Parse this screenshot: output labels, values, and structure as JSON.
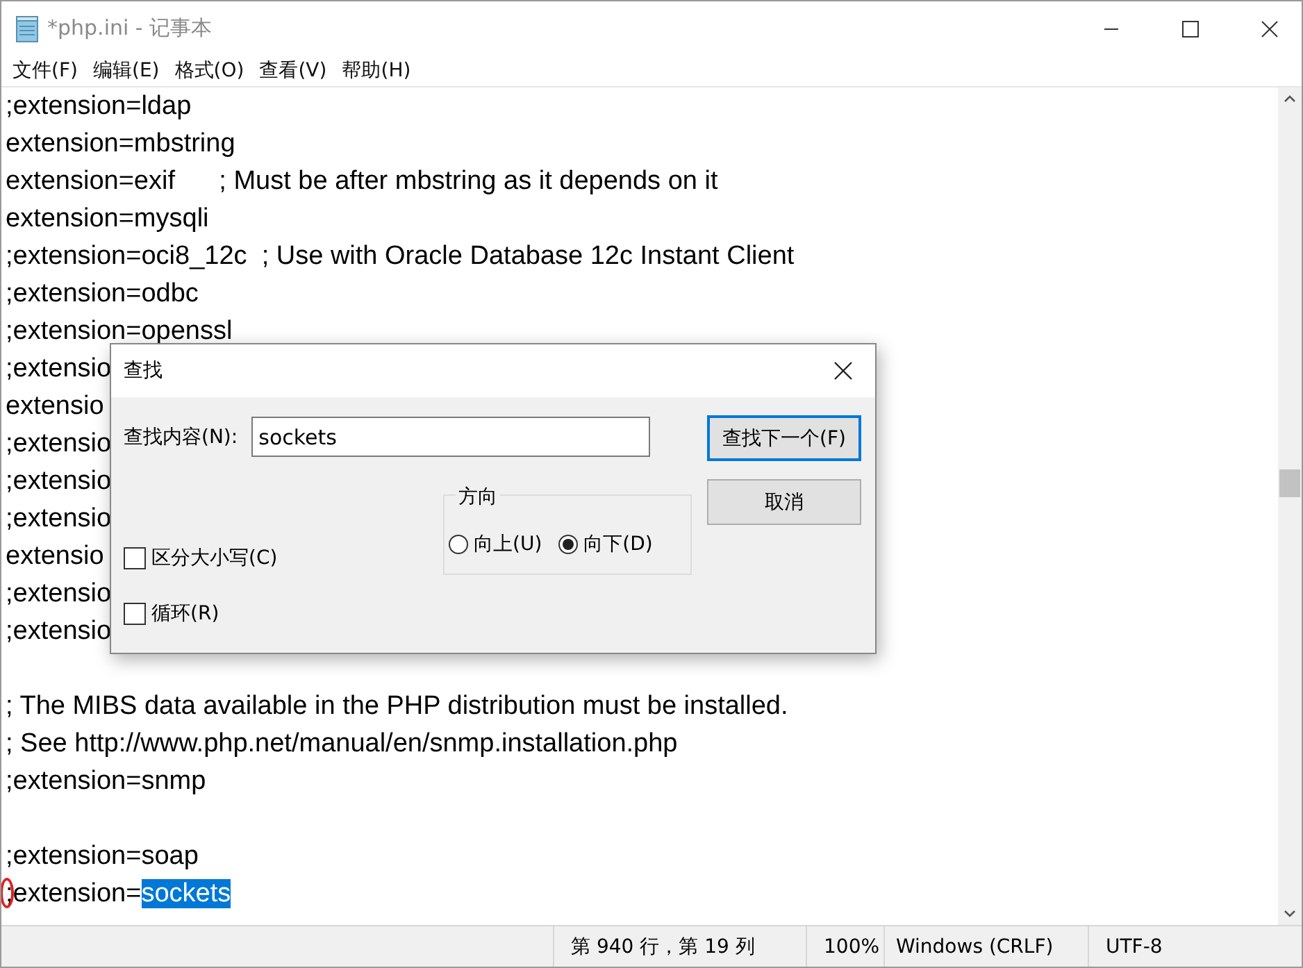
{
  "window": {
    "title": "*php.ini - 记事本"
  },
  "menu": [
    "文件(F)",
    "编辑(E)",
    "格式(O)",
    "查看(V)",
    "帮助(H)"
  ],
  "editor": {
    "lines": [
      {
        "kind": "text",
        "text": ";extension=ldap",
        "circled": false
      },
      {
        "kind": "text",
        "text": "extension=mbstring",
        "circled": false
      },
      {
        "kind": "text",
        "text": "extension=exif      ; Must be after mbstring as it depends on it",
        "circled": false
      },
      {
        "kind": "text",
        "text": "extension=mysqli",
        "circled": false
      },
      {
        "kind": "text",
        "text": ";extension=oci8_12c  ; Use with Oracle Database 12c Instant Client",
        "circled": false
      },
      {
        "kind": "text",
        "text": ";extension=odbc",
        "circled": false
      },
      {
        "kind": "text",
        "text": ";extension=openssl",
        "circled": false
      },
      {
        "kind": "text",
        "text": ";extensio",
        "circled": false
      },
      {
        "kind": "text",
        "text": "extensio",
        "circled": false
      },
      {
        "kind": "text",
        "text": ";extensio",
        "circled": false
      },
      {
        "kind": "text",
        "text": ";extensio",
        "circled": false
      },
      {
        "kind": "text",
        "text": ";extensio",
        "circled": false
      },
      {
        "kind": "text",
        "text": "extensio",
        "circled": false
      },
      {
        "kind": "text",
        "text": ";extensio",
        "circled": false
      },
      {
        "kind": "text",
        "text": ";extensio",
        "circled": false
      },
      {
        "kind": "blank"
      },
      {
        "kind": "text",
        "text": "; The MIBS data available in the PHP distribution must be installed.",
        "circled": false
      },
      {
        "kind": "text",
        "text": "; See http://www.php.net/manual/en/snmp.installation.php",
        "circled": false
      },
      {
        "kind": "text",
        "text": ";extension=snmp",
        "circled": false
      },
      {
        "kind": "blank"
      },
      {
        "kind": "text",
        "text": ";extension=soap",
        "circled": false
      },
      {
        "kind": "text",
        "text": ";extension=",
        "selection": "sockets",
        "circled": true
      }
    ]
  },
  "find_dialog": {
    "title": "查找",
    "find_label": "查找内容(N):",
    "find_value": "sockets",
    "checkboxes": [
      {
        "label": "区分大小写(C)",
        "checked": false
      },
      {
        "label": "循环(R)",
        "checked": false
      }
    ],
    "direction": {
      "legend": "方向",
      "options": [
        {
          "label": "向上(U)",
          "selected": false
        },
        {
          "label": "向下(D)",
          "selected": true
        }
      ]
    },
    "buttons": [
      {
        "label": "查找下一个(F)",
        "default": true
      },
      {
        "label": "取消",
        "default": false
      }
    ]
  },
  "status_bar": [
    "第 940 行，第 19 列",
    "100%",
    "Windows (CRLF)",
    "UTF-8"
  ]
}
